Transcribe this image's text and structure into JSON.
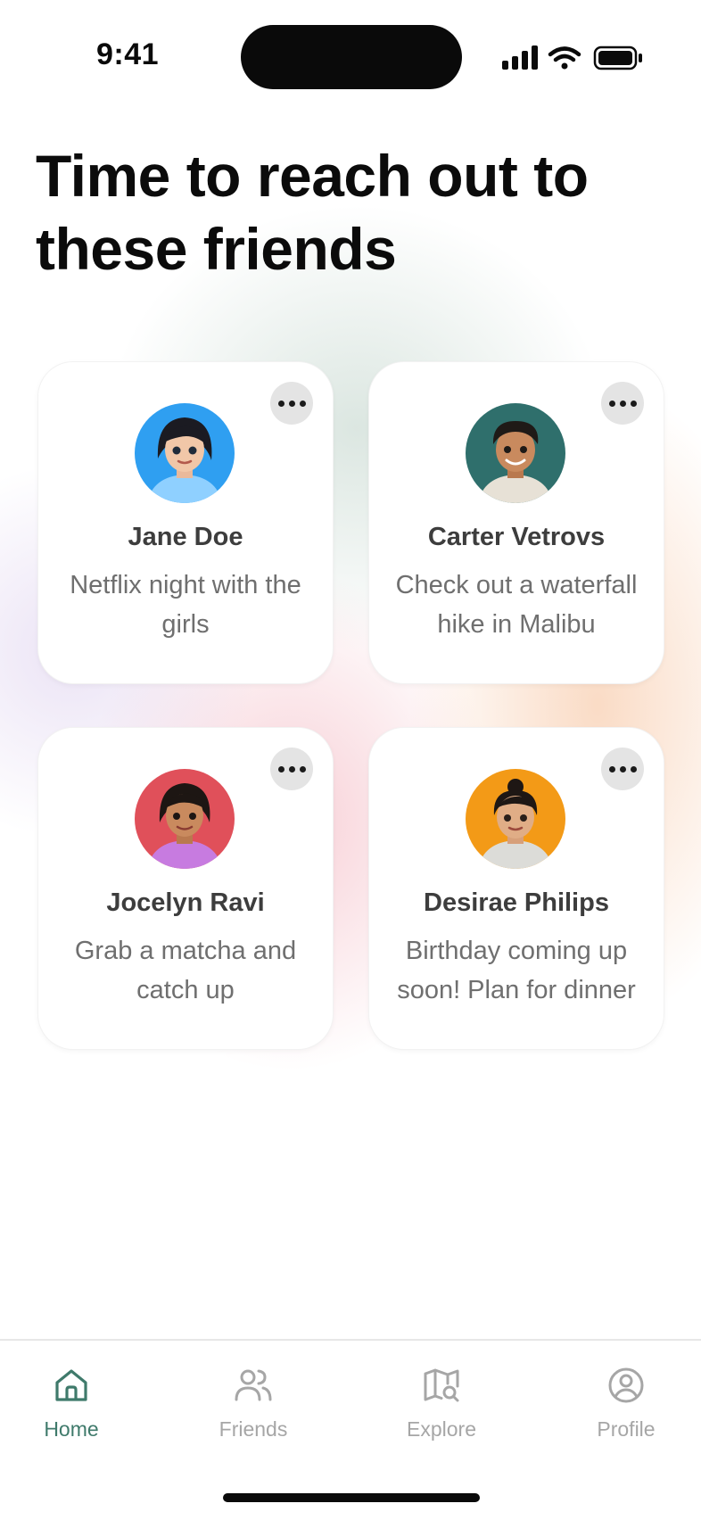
{
  "status_bar": {
    "time": "9:41",
    "icons": [
      "cellular-signal-icon",
      "wifi-icon",
      "battery-icon"
    ]
  },
  "header": {
    "title": "Time to reach out to these friends"
  },
  "friends": [
    {
      "name": "Jane Doe",
      "note": "Netflix night with the girls",
      "avatar_bg": "#2f9ff1",
      "avatar_icon": "avatar-jane-doe"
    },
    {
      "name": "Carter Vetrovs",
      "note": "Check out a waterfall hike in Malibu",
      "avatar_bg": "#2f6f6c",
      "avatar_icon": "avatar-carter-vetrovs"
    },
    {
      "name": "Jocelyn Ravi",
      "note": "Grab a matcha and catch up",
      "avatar_bg": "#e0505a",
      "avatar_icon": "avatar-jocelyn-ravi"
    },
    {
      "name": "Desirae Philips",
      "note": "Birthday coming up soon! Plan for dinner",
      "avatar_bg": "#f39a17",
      "avatar_icon": "avatar-desirae-philips"
    }
  ],
  "tab_bar": {
    "items": [
      {
        "label": "Home",
        "icon": "home-icon",
        "active": true
      },
      {
        "label": "Friends",
        "icon": "friends-icon",
        "active": false
      },
      {
        "label": "Explore",
        "icon": "map-search-icon",
        "active": false
      },
      {
        "label": "Profile",
        "icon": "profile-icon",
        "active": false
      }
    ]
  },
  "colors": {
    "accent": "#3f7a6b",
    "inactive_tab": "#a6a6a6",
    "title": "#0b0b0b",
    "name": "#3d3d3d",
    "note": "#6f6f6f",
    "more_button_bg": "#e4e4e4"
  }
}
